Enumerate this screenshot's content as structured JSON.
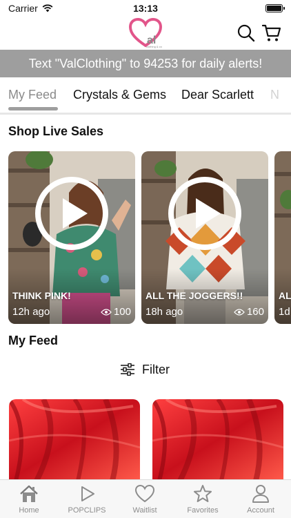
{
  "status_bar": {
    "carrier": "Carrier",
    "time": "13:13"
  },
  "header": {
    "logo_text": "al",
    "logo_subtext": "clothing & co"
  },
  "banner": {
    "text": "Text \"ValClothing\" to 94253 for daily alerts!"
  },
  "tabs": [
    {
      "label": "My Feed",
      "active": true
    },
    {
      "label": "Crystals & Gems",
      "active": false
    },
    {
      "label": "Dear Scarlett",
      "active": false
    },
    {
      "label": "N",
      "active": false
    }
  ],
  "live_section": {
    "title": "Shop Live Sales",
    "cards": [
      {
        "title": "THINK PINK!",
        "time": "12h ago",
        "views": "100"
      },
      {
        "title": "ALL THE JOGGERS!!",
        "time": "18h ago",
        "views": "160"
      },
      {
        "title": "AL",
        "time": "1d"
      }
    ]
  },
  "feed": {
    "title": "My Feed",
    "filter_label": "Filter"
  },
  "bottom_nav": [
    {
      "label": "Home",
      "icon": "home-icon"
    },
    {
      "label": "POPCLIPS",
      "icon": "play-icon"
    },
    {
      "label": "Waitlist",
      "icon": "heart-icon"
    },
    {
      "label": "Favorites",
      "icon": "star-icon"
    },
    {
      "label": "Account",
      "icon": "person-icon"
    }
  ],
  "colors": {
    "brand_pink": "#e2558a",
    "banner_gray": "#9e9e9e",
    "nav_gray": "#8c8c8c"
  }
}
